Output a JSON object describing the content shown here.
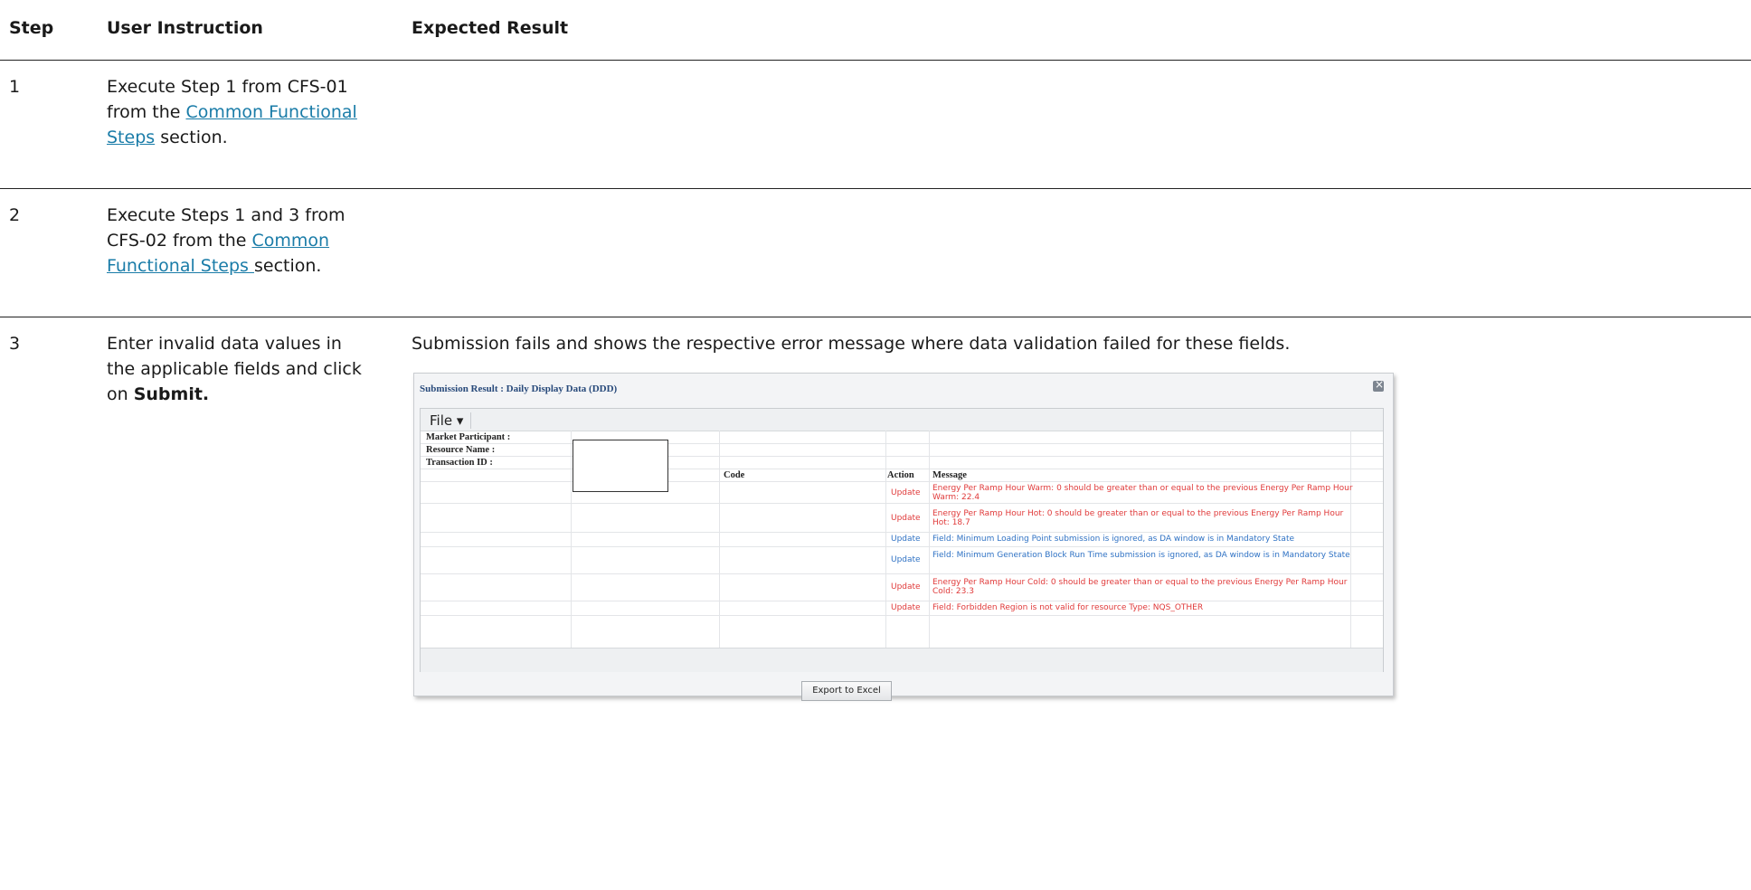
{
  "headers": {
    "step": "Step",
    "instruction": "User Instruction",
    "expected": "Expected Result"
  },
  "rows": [
    {
      "step": "1",
      "lines": [
        "Execute Step 1 from CFS-01",
        "from the ",
        "Common Functional",
        "Steps",
        " section."
      ]
    },
    {
      "step": "2",
      "lines": [
        "Execute Steps 1 and 3 from",
        "CFS-02 from the ",
        "Common",
        "Functional Steps ",
        "section."
      ]
    },
    {
      "step": "3",
      "lines": [
        "Enter invalid data values in",
        "the applicable fields and click",
        "on ",
        "Submit."
      ],
      "expected": "Submission fails and shows the respective error message where data validation failed for these fields."
    }
  ],
  "screenshot": {
    "title": "Submission Result : Daily Display Data (DDD)",
    "file_menu": "File ▾",
    "labels": [
      "Market Participant :",
      "Resource Name :",
      "Transaction ID :"
    ],
    "columns": {
      "code": "Code",
      "action": "Action",
      "message": "Message"
    },
    "messages": [
      {
        "action": "Update",
        "text": "Energy Per Ramp Hour Warm: 0 should be greater than or equal to the previous Energy Per Ramp Hour Warm: 22.4",
        "color": "#e03a3a"
      },
      {
        "action": "Update",
        "text": "Energy Per Ramp Hour Hot: 0 should be greater than or equal to the previous Energy Per Ramp Hour Hot: 18.7",
        "color": "#e03a3a"
      },
      {
        "action": "Update",
        "text": "Field: Minimum Loading Point submission is ignored, as DA window is in Mandatory State",
        "color": "#2f72c4"
      },
      {
        "action": "Update",
        "text": "Field: Minimum Generation Block Run Time submission is ignored, as DA window is in Mandatory State",
        "color": "#2f72c4"
      },
      {
        "action": "Update",
        "text": "Energy Per Ramp Hour Cold: 0 should be greater than or equal to the previous Energy Per Ramp Hour Cold: 23.3",
        "color": "#e03a3a"
      },
      {
        "action": "Update",
        "text": "Field: Forbidden Region is not valid for resource Type: NQS_OTHER",
        "color": "#e03a3a"
      }
    ],
    "export_button": "Export to Excel"
  }
}
